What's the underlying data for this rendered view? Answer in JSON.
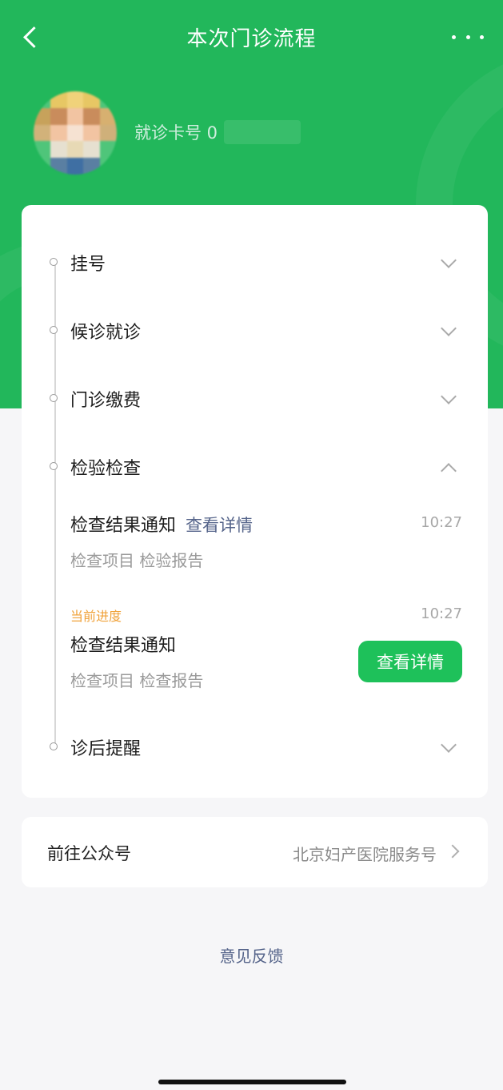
{
  "header": {
    "title": "本次门诊流程",
    "card_no_label": "就诊卡号 0"
  },
  "flow": {
    "steps": [
      {
        "label": "挂号",
        "state": "collapsed"
      },
      {
        "label": "候诊就诊",
        "state": "collapsed"
      },
      {
        "label": "门诊缴费",
        "state": "collapsed"
      },
      {
        "label": "检验检查",
        "state": "expanded"
      },
      {
        "label": "诊后提醒",
        "state": "collapsed"
      }
    ],
    "exam_items": [
      {
        "title": "检查结果通知",
        "link": "查看详情",
        "time": "10:27",
        "meta": "检查项目 检验报告"
      },
      {
        "tag": "当前进度",
        "title": "检查结果通知",
        "time": "10:27",
        "meta": "检查项目 检查报告",
        "button": "查看详情"
      }
    ]
  },
  "official_account": {
    "label": "前往公众号",
    "value": "北京妇产医院服务号"
  },
  "feedback": "意见反馈",
  "colors": {
    "brand_green": "#22b75b",
    "button_green": "#1ec15a",
    "progress_orange": "#f0a23a",
    "link_blue": "#55648a"
  },
  "icons": [
    "back-icon",
    "more-icon",
    "chevron-down-icon",
    "chevron-up-icon",
    "chevron-right-icon"
  ]
}
